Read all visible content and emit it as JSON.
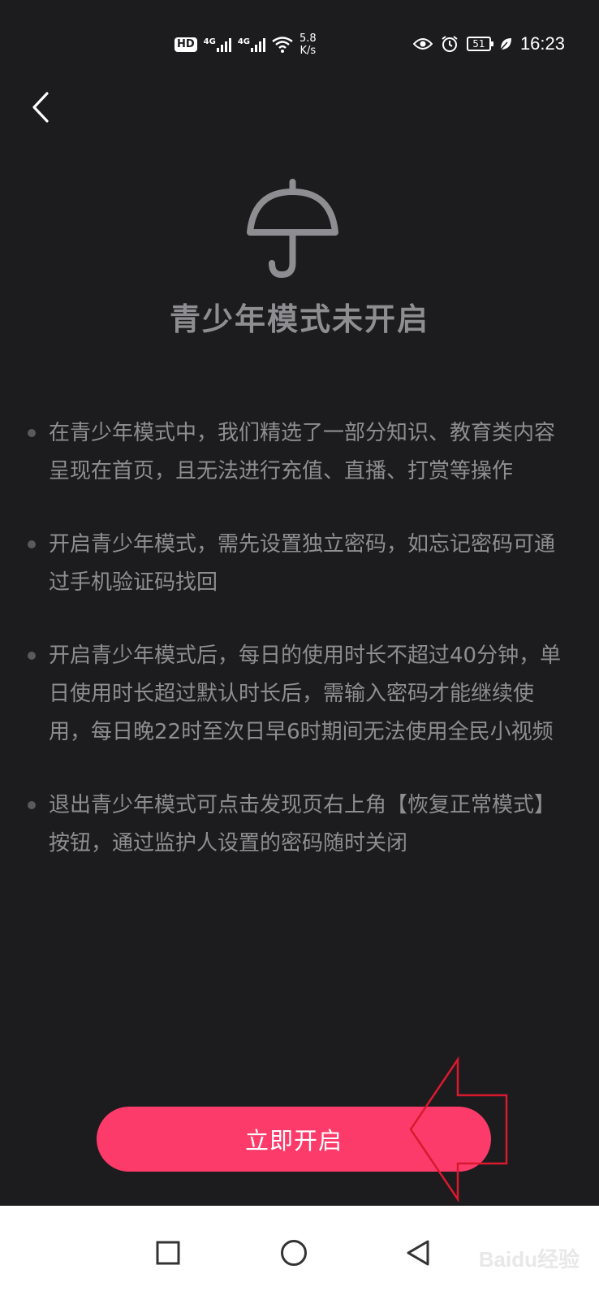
{
  "status_bar": {
    "hd_badge": "HD",
    "network_1": "4G",
    "network_2": "4G",
    "speed_value": "5.8",
    "speed_unit": "K/s",
    "battery": "51",
    "time": "16:23"
  },
  "header": {
    "back_icon": "chevron-left-icon"
  },
  "hero": {
    "icon": "umbrella-icon",
    "title": "青少年模式未开启"
  },
  "info_items": [
    {
      "text": "在青少年模式中，我们精选了一部分知识、教育类内容呈现在首页，且无法进行充值、直播、打赏等操作"
    },
    {
      "text": "开启青少年模式，需先设置独立密码，如忘记密码可通过手机验证码找回"
    },
    {
      "text": "开启青少年模式后，每日的使用时长不超过40分钟，单日使用时长超过默认时长后，需输入密码才能继续使用，每日晚22时至次日早6时期间无法使用全民小视频"
    },
    {
      "text": "退出青少年模式可点击发现页右上角【恢复正常模式】按钮，通过监护人设置的密码随时关闭"
    }
  ],
  "cta": {
    "label": "立即开启",
    "color": "#fd3b6b"
  },
  "nav_bar": {
    "recent": "square-icon",
    "home": "circle-icon",
    "back": "triangle-back-icon"
  },
  "watermark": "Baidu经验"
}
